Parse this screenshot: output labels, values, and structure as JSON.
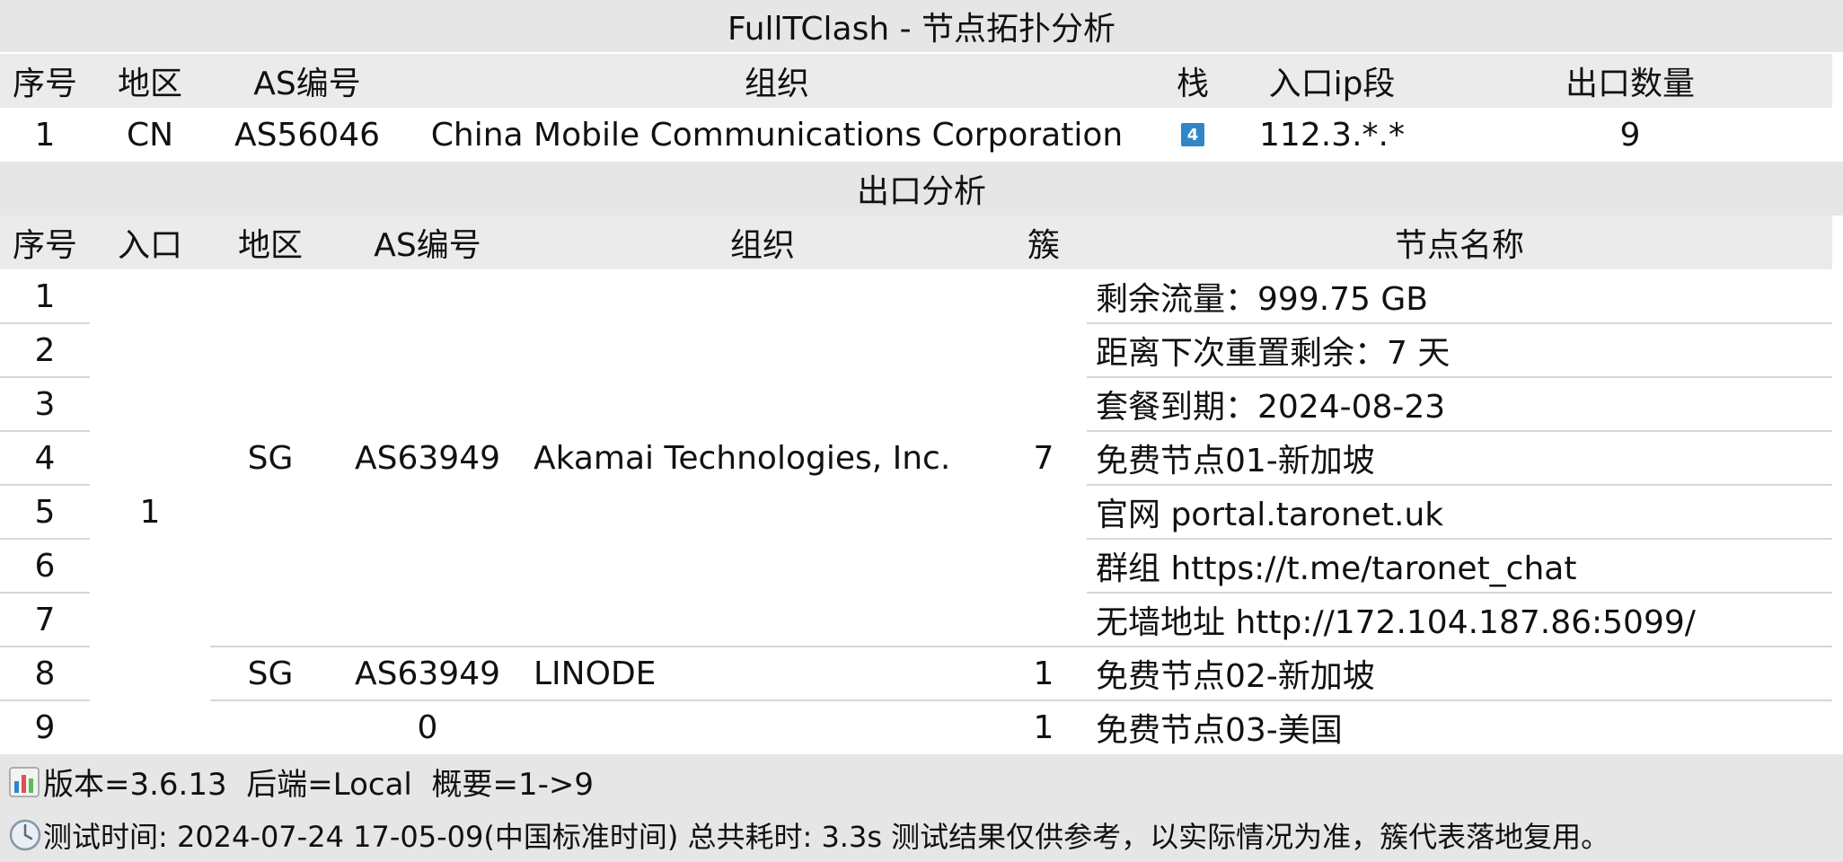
{
  "title": "FullTClash - 节点拓扑分析",
  "entry_table": {
    "headers": {
      "index": "序号",
      "region": "地区",
      "asn": "AS编号",
      "org": "组织",
      "stack": "栈",
      "ip_segment": "入口ip段",
      "exit_count": "出口数量"
    },
    "row": {
      "index": "1",
      "region": "CN",
      "asn": "AS56046",
      "org": "China Mobile Communications Corporation",
      "stack": "4",
      "ip_segment": "112.3.*.*",
      "exit_count": "9"
    }
  },
  "exit_section_title": "出口分析",
  "exit_table": {
    "headers": {
      "index": "序号",
      "entry": "入口",
      "region": "地区",
      "asn": "AS编号",
      "org": "组织",
      "cluster": "簇",
      "node_name": "节点名称"
    },
    "indices": [
      "1",
      "2",
      "3",
      "4",
      "5",
      "6",
      "7",
      "8",
      "9"
    ],
    "entry_value": "1",
    "groups": [
      {
        "region": "SG",
        "asn": "AS63949",
        "org": "Akamai Technologies, Inc.",
        "cluster": "7"
      },
      {
        "region": "SG",
        "asn": "AS63949",
        "org": "LINODE",
        "cluster": "1"
      },
      {
        "region": "",
        "asn": "0",
        "org": "",
        "cluster": "1"
      }
    ],
    "node_names": [
      "剩余流量：999.75 GB",
      "距离下次重置剩余：7 天",
      "套餐到期：2024-08-23",
      "免费节点01-新加坡",
      "官网 portal.taronet.uk",
      "群组 https://t.me/taronet_chat",
      "无墙地址 http://172.104.187.86:5099/",
      "免费节点02-新加坡",
      "免费节点03-美国"
    ]
  },
  "footer": {
    "info_line": "版本=3.6.13  后端=Local  概要=1->9",
    "time_line": "测试时间: 2024-07-24 17-05-09(中国标准时间) 总共耗时: 3.3s 测试结果仅供参考，以实际情况为准，簇代表落地复用。"
  },
  "colors": {
    "header_bg": "#ebebeb",
    "footer_bg": "#e6e6e6",
    "ipv4_badge": "#2f87c8"
  },
  "icons": {
    "stack": "ipv4-badge",
    "footer_info": "bar-chart-icon",
    "footer_time": "clock-icon"
  }
}
